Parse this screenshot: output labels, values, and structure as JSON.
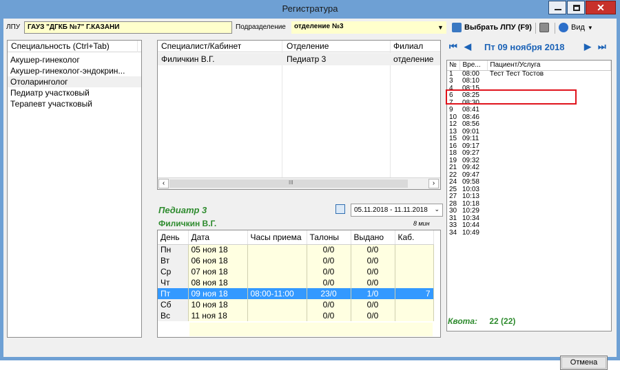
{
  "window": {
    "title": "Регистратура"
  },
  "toolbar": {
    "lpu_label": "ЛПУ",
    "lpu_value": "ГАУЗ \"ДГКБ №7\" Г.КАЗАНИ",
    "dept_label": "Подразделение",
    "dept_value": "отделение №3",
    "choose_lpu": "Выбрать ЛПУ (F9)",
    "view_label": "Вид"
  },
  "specialties": {
    "header": "Специальность (Ctrl+Tab)",
    "items": [
      "Акушер-гинеколог",
      "Акушер-гинеколог-эндокрин...",
      "Отоларинголог",
      "Педиатр участковый",
      "Терапевт участковый"
    ]
  },
  "specialists": {
    "headers": [
      "Специалист/Кабинет",
      "Отделение",
      "Филиал"
    ],
    "rows": [
      {
        "name": "Филичкин В.Г.",
        "dept": "Педиатр 3",
        "branch": "отделение"
      }
    ]
  },
  "schedule": {
    "title": "Педиатр 3",
    "doctor": "Филичкин В.Г.",
    "duration": "8 мин",
    "date_range": "05.11.2018 - 11.11.2018",
    "headers": [
      "День",
      "Дата",
      "Часы приема",
      "Талоны",
      "Выдано",
      "Каб."
    ],
    "rows": [
      {
        "day": "Пн",
        "date": "05 ноя 18",
        "hours": "",
        "tickets": "0/0",
        "issued": "0/0",
        "cab": ""
      },
      {
        "day": "Вт",
        "date": "06 ноя 18",
        "hours": "",
        "tickets": "0/0",
        "issued": "0/0",
        "cab": ""
      },
      {
        "day": "Ср",
        "date": "07 ноя 18",
        "hours": "",
        "tickets": "0/0",
        "issued": "0/0",
        "cab": ""
      },
      {
        "day": "Чт",
        "date": "08 ноя 18",
        "hours": "",
        "tickets": "0/0",
        "issued": "0/0",
        "cab": ""
      },
      {
        "day": "Пт",
        "date": "09 ноя 18",
        "hours": "08:00-11:00",
        "tickets": "23/0",
        "issued": "1/0",
        "cab": "7"
      },
      {
        "day": "Сб",
        "date": "10 ноя 18",
        "hours": "",
        "tickets": "0/0",
        "issued": "0/0",
        "cab": ""
      },
      {
        "day": "Вс",
        "date": "11 ноя 18",
        "hours": "",
        "tickets": "0/0",
        "issued": "0/0",
        "cab": ""
      }
    ]
  },
  "slots": {
    "date": "Пт 09 ноября 2018",
    "headers": [
      "№",
      "Вре...",
      "Пациент/Услуга"
    ],
    "rows": [
      {
        "n": "1",
        "t": "08:00",
        "p": "Тест Тест Тостов"
      },
      {
        "n": "3",
        "t": "08:10",
        "p": ""
      },
      {
        "n": "4",
        "t": "08:15",
        "p": ""
      },
      {
        "n": "6",
        "t": "08:25",
        "p": ""
      },
      {
        "n": "7",
        "t": "08:30",
        "p": ""
      },
      {
        "n": "9",
        "t": "08:41",
        "p": ""
      },
      {
        "n": "10",
        "t": "08:46",
        "p": ""
      },
      {
        "n": "12",
        "t": "08:56",
        "p": ""
      },
      {
        "n": "13",
        "t": "09:01",
        "p": ""
      },
      {
        "n": "15",
        "t": "09:11",
        "p": ""
      },
      {
        "n": "16",
        "t": "09:17",
        "p": ""
      },
      {
        "n": "18",
        "t": "09:27",
        "p": ""
      },
      {
        "n": "19",
        "t": "09:32",
        "p": ""
      },
      {
        "n": "21",
        "t": "09:42",
        "p": ""
      },
      {
        "n": "22",
        "t": "09:47",
        "p": ""
      },
      {
        "n": "24",
        "t": "09:58",
        "p": ""
      },
      {
        "n": "25",
        "t": "10:03",
        "p": ""
      },
      {
        "n": "27",
        "t": "10:13",
        "p": ""
      },
      {
        "n": "28",
        "t": "10:18",
        "p": ""
      },
      {
        "n": "30",
        "t": "10:29",
        "p": ""
      },
      {
        "n": "31",
        "t": "10:34",
        "p": ""
      },
      {
        "n": "33",
        "t": "10:44",
        "p": ""
      },
      {
        "n": "34",
        "t": "10:49",
        "p": ""
      }
    ],
    "quota_label": "Квота:",
    "quota_value": "22 (22)"
  },
  "footer": {
    "cancel": "Отмена"
  },
  "colors": {
    "selection": "#3399ff",
    "accent_green": "#2e8b2e",
    "highlight": "#e0121b",
    "title_bar": "#6ea0d4"
  }
}
